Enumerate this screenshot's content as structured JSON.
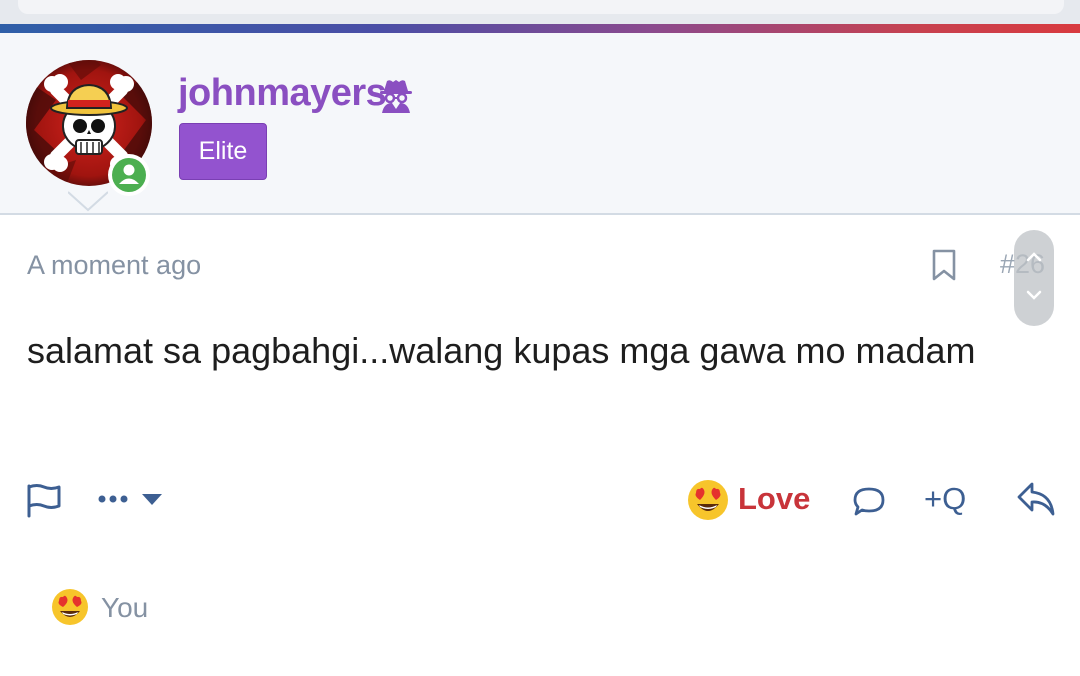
{
  "post": {
    "username": "johnmayers",
    "role": "Elite",
    "date": "A moment ago",
    "number": "#26",
    "message": "salamat sa pagbahgi...walang kupas mga gawa mo madam"
  },
  "actions": {
    "reaction_label": "Love",
    "quote_label": "+Q"
  },
  "reactions_summary": {
    "text": "You"
  },
  "icons": {
    "badge": "spy-icon",
    "status": "online-user-icon",
    "bookmark": "bookmark-icon",
    "report": "flag-icon",
    "more": "more-menu-icon",
    "reaction": "heart-eyes-emoji",
    "comment": "comment-bubble-icon",
    "reply": "reply-arrow-icon"
  },
  "colors": {
    "username": "#8a4fc1",
    "role_badge": "#9353cf",
    "love": "#c8343a",
    "action_icons": "#3d5f92",
    "online": "#4caf50"
  }
}
